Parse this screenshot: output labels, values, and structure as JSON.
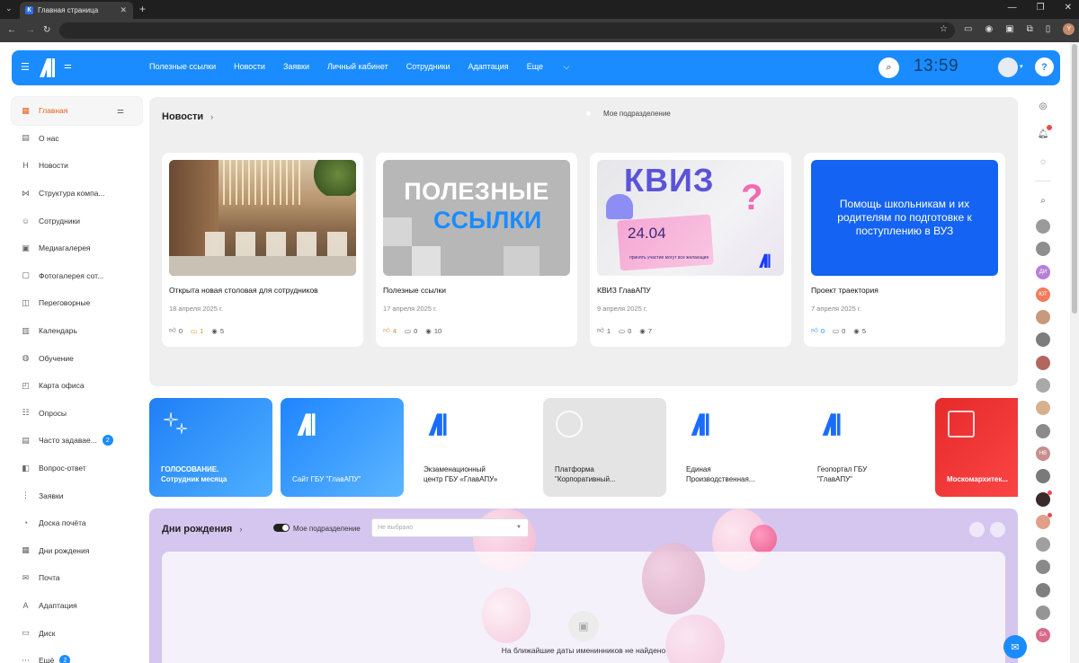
{
  "browser": {
    "tab_title": "Главная страница",
    "tab_favicon": "К"
  },
  "topnav": {
    "links": [
      "Полезные ссылки",
      "Новости",
      "Заявки",
      "Личный кабинет",
      "Сотрудники",
      "Адаптация",
      "Еще"
    ],
    "clock": "13:59",
    "help": "?"
  },
  "sidebar": {
    "items": [
      {
        "label": "Главная",
        "icon": "home-grid-icon",
        "glyph": "▦"
      },
      {
        "label": "О нас",
        "icon": "building-icon",
        "glyph": "▤"
      },
      {
        "label": "Новости",
        "icon": "news-icon",
        "glyph": "Н"
      },
      {
        "label": "Структура компа...",
        "icon": "structure-icon",
        "glyph": "⋈"
      },
      {
        "label": "Сотрудники",
        "icon": "people-icon",
        "glyph": "☺"
      },
      {
        "label": "Медиагалерея",
        "icon": "media-icon",
        "glyph": "▣"
      },
      {
        "label": "Фотогалерея сот...",
        "icon": "photo-icon",
        "glyph": "▢"
      },
      {
        "label": "Переговорные",
        "icon": "meeting-room-icon",
        "glyph": "◫"
      },
      {
        "label": "Календарь",
        "icon": "calendar-icon",
        "glyph": "▥"
      },
      {
        "label": "Обучение",
        "icon": "learning-icon",
        "glyph": "◍"
      },
      {
        "label": "Карта офиса",
        "icon": "map-icon",
        "glyph": "◰"
      },
      {
        "label": "Опросы",
        "icon": "survey-icon",
        "glyph": "☷"
      },
      {
        "label": "Часто задавае...",
        "icon": "faq-icon",
        "glyph": "▤",
        "badge": "2"
      },
      {
        "label": "Вопрос-ответ",
        "icon": "qa-icon",
        "glyph": "◧"
      },
      {
        "label": "Заявки",
        "icon": "requests-icon",
        "glyph": "⋮"
      },
      {
        "label": "Доска почёта",
        "icon": "honor-icon",
        "glyph": "◔"
      },
      {
        "label": "Дни рождения",
        "icon": "birthday-icon",
        "glyph": "▦"
      },
      {
        "label": "Почта",
        "icon": "mail-icon",
        "glyph": "✉"
      },
      {
        "label": "Адаптация",
        "icon": "adaptation-icon",
        "glyph": "A"
      },
      {
        "label": "Диск",
        "icon": "disk-icon",
        "glyph": "▭"
      },
      {
        "label": "Ещё",
        "icon": "more-icon",
        "glyph": "⋯",
        "badge": "2"
      }
    ]
  },
  "news": {
    "title": "Новости",
    "my_dept": "Мое подразделение",
    "cards": [
      {
        "title": "Открыта новая столовая для сотрудников",
        "date": "18 апреля 2025 г.",
        "likes": "0",
        "comments": "1",
        "views": "5"
      },
      {
        "title": "Полезные ссылки",
        "date": "17 апреля 2025 г.",
        "likes": "4",
        "comments": "0",
        "views": "10",
        "image_line1": "ПОЛЕЗНЫЕ",
        "image_line2": "ССЫЛКИ"
      },
      {
        "title": "КВИЗ ГлавАПУ",
        "date": "9 апреля 2025 г.",
        "likes": "1",
        "comments": "0",
        "views": "7",
        "image_word": "КВИЗ",
        "image_date": "24.04",
        "image_sub": "принять участие могут все желающие"
      },
      {
        "title": "Проект траектория",
        "date": "7 апреля 2025 г.",
        "likes": "0",
        "comments": "0",
        "views": "5",
        "image_text": "Помощь школьникам и их родителям по подготовке к поступлению в ВУЗ"
      }
    ]
  },
  "services": [
    {
      "label": "ГОЛОСОВАНИЕ.\nСотрудник месяца"
    },
    {
      "label": "Сайт ГБУ \"ГлавАПУ\""
    },
    {
      "label": "Экзаменационный\nцентр ГБУ «ГлавАПУ»"
    },
    {
      "label": "Платформа\n\"Корпоративный..."
    },
    {
      "label": "Единая\nПроизводственная..."
    },
    {
      "label": "Геопортал ГБУ\n\"ГлавАПУ\""
    },
    {
      "label": "Москомархитек..."
    }
  ],
  "birthdays": {
    "title": "Дни рождения",
    "my_dept": "Мое подразделение",
    "select_placeholder": "Не выбрано",
    "empty": "На ближайшие даты именинников не найдено"
  },
  "rail": {
    "avatars": [
      {
        "initials": "",
        "color": "#9a9a9a"
      },
      {
        "initials": "",
        "color": "#8e8e8e"
      },
      {
        "initials": "ДИ",
        "color": "#b67fd6"
      },
      {
        "initials": "ЮТ",
        "color": "#f07c5a"
      },
      {
        "initials": "",
        "color": "#c79a7e"
      },
      {
        "initials": "",
        "color": "#7d7d7d"
      },
      {
        "initials": "",
        "color": "#b3665e"
      },
      {
        "initials": "",
        "color": "#a9a9a9"
      },
      {
        "initials": "",
        "color": "#d7b08d"
      },
      {
        "initials": "",
        "color": "#8b8b8b"
      },
      {
        "initials": "НВ",
        "color": "#c88d8d"
      },
      {
        "initials": "",
        "color": "#7a7a7a"
      },
      {
        "initials": "",
        "color": "#3a2a2a"
      },
      {
        "initials": "",
        "color": "#e0a08a"
      },
      {
        "initials": "",
        "color": "#a0a0a0"
      },
      {
        "initials": "",
        "color": "#8a8a8a"
      },
      {
        "initials": "",
        "color": "#7f7f7f"
      },
      {
        "initials": "",
        "color": "#959595"
      },
      {
        "initials": "БА",
        "color": "#d86a88"
      }
    ]
  },
  "colors": {
    "accent": "#1a8cff",
    "active": "#e85d1a",
    "birthday_bg": "#d4c6ef"
  }
}
